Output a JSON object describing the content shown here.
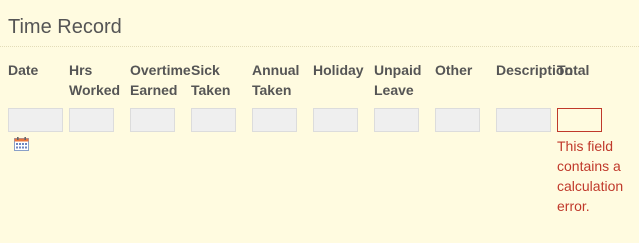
{
  "section": {
    "title": "Time Record"
  },
  "columns": [
    {
      "key": "date",
      "header": "Date",
      "value": ""
    },
    {
      "key": "hrs_worked",
      "header": "Hrs Worked",
      "value": ""
    },
    {
      "key": "overtime_earned",
      "header": "Overtime Earned",
      "value": ""
    },
    {
      "key": "sick_taken",
      "header": "Sick Taken",
      "value": ""
    },
    {
      "key": "annual_taken",
      "header": "Annual Taken",
      "value": ""
    },
    {
      "key": "holiday",
      "header": "Holiday",
      "value": ""
    },
    {
      "key": "unpaid_leave",
      "header": "Unpaid Leave",
      "value": ""
    },
    {
      "key": "other",
      "header": "Other",
      "value": ""
    },
    {
      "key": "description",
      "header": "Description",
      "value": ""
    },
    {
      "key": "total",
      "header": "Total",
      "value": ""
    }
  ],
  "date_picker": {
    "icon": "calendar-icon"
  },
  "validation": {
    "total_error": "This field contains a calculation error.",
    "error_color": "#c0392b"
  },
  "colors": {
    "background": "#fffbe0",
    "field_bg": "#efefef"
  }
}
